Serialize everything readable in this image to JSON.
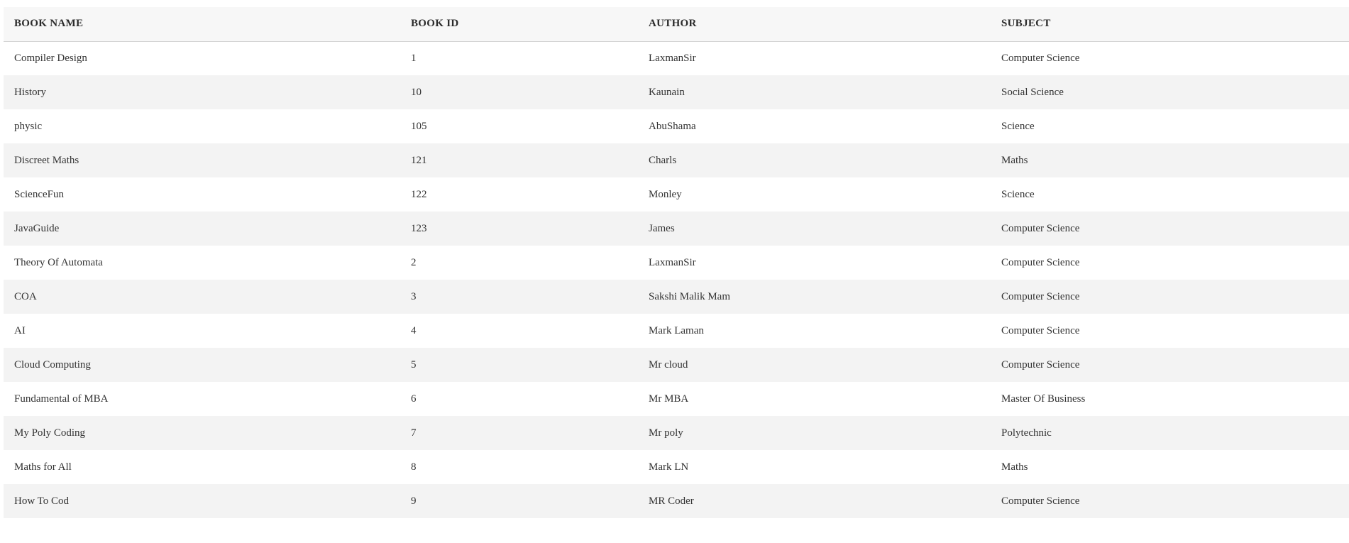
{
  "table": {
    "headers": [
      "BOOK NAME",
      "BOOK ID",
      "AUTHOR",
      "SUBJECT"
    ],
    "rows": [
      [
        "Compiler Design",
        "1",
        "LaxmanSir",
        "Computer Science"
      ],
      [
        "History",
        "10",
        "Kaunain",
        "Social Science"
      ],
      [
        "physic",
        "105",
        "AbuShama",
        "Science"
      ],
      [
        "Discreet Maths",
        "121",
        "Charls",
        "Maths"
      ],
      [
        "ScienceFun",
        "122",
        "Monley",
        "Science"
      ],
      [
        "JavaGuide",
        "123",
        "James",
        "Computer Science"
      ],
      [
        "Theory Of Automata",
        "2",
        "LaxmanSir",
        "Computer Science"
      ],
      [
        "COA",
        "3",
        "Sakshi Malik Mam",
        "Computer Science"
      ],
      [
        "AI",
        "4",
        "Mark Laman",
        "Computer Science"
      ],
      [
        "Cloud Computing",
        "5",
        "Mr cloud",
        "Computer Science"
      ],
      [
        "Fundamental of MBA",
        "6",
        "Mr MBA",
        "Master Of Business"
      ],
      [
        "My Poly Coding",
        "7",
        "Mr poly",
        "Polytechnic"
      ],
      [
        "Maths for All",
        "8",
        "Mark LN",
        "Maths"
      ],
      [
        "How To Cod",
        "9",
        "MR Coder",
        "Computer Science"
      ]
    ]
  }
}
